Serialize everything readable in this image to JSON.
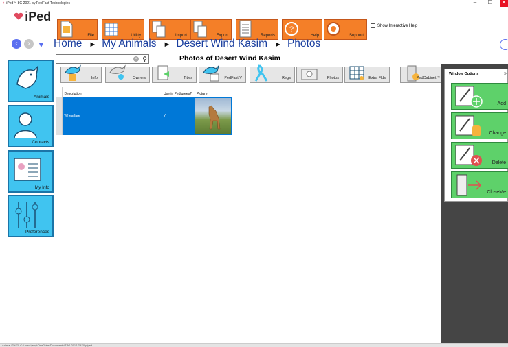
{
  "window": {
    "title": "iPed™ 8G 2021 by PedFast Technologies",
    "min_glyph": "–",
    "max_glyph": "☐",
    "close_glyph": "✕"
  },
  "logo": {
    "text": "iPed"
  },
  "toolbar": {
    "buttons": [
      {
        "label": "File",
        "icon": "file-icon"
      },
      {
        "label": "Utility",
        "icon": "utility-icon"
      },
      {
        "label": "Import",
        "icon": "import-icon"
      },
      {
        "label": "Export",
        "icon": "export-icon"
      },
      {
        "label": "Reports",
        "icon": "reports-icon"
      },
      {
        "label": "Help",
        "icon": "help-icon"
      },
      {
        "label": "Support",
        "icon": "support-icon"
      }
    ],
    "show_help_label": "Show Interactive Help",
    "show_help_checked": false
  },
  "breadcrumb": [
    "Home",
    "My Animals",
    "Desert Wind Kasim",
    "Photos"
  ],
  "breadcrumb_separator": "►",
  "nav": {
    "back_glyph": "‹",
    "fwd_glyph": "›",
    "menu_glyph": "▼"
  },
  "left_nav": [
    {
      "label": "Animals",
      "icon": "dog-head-icon"
    },
    {
      "label": "Contacts",
      "icon": "person-icon"
    },
    {
      "label": "My Info",
      "icon": "id-card-icon"
    },
    {
      "label": "Preferences",
      "icon": "sliders-icon"
    }
  ],
  "search": {
    "value": "",
    "placeholder": "",
    "clear_glyph": "×",
    "find_glyph": "⚲"
  },
  "page_title": "Photos of Desert Wind Kasim",
  "tabs": [
    {
      "label": "Info"
    },
    {
      "label": "Owners"
    },
    {
      "label": "Titles"
    },
    {
      "label": "PedFast V"
    },
    {
      "label": "Regs"
    },
    {
      "label": "Photos"
    },
    {
      "label": "Extra Flds"
    },
    {
      "label": "PedCabinet™"
    }
  ],
  "grid": {
    "columns": [
      "Description",
      "Use in Pedigrees?",
      "Picture"
    ],
    "rows": [
      {
        "description": "Wheatfare",
        "use_in_pedigrees": "Y",
        "picture": "dog-photo"
      }
    ]
  },
  "window_options": {
    "title": "Window Options",
    "pin_glyph": "»",
    "buttons": [
      {
        "label": "Add",
        "icon": "add-icon"
      },
      {
        "label": "Change",
        "icon": "change-icon"
      },
      {
        "label": "Delete",
        "icon": "delete-icon"
      },
      {
        "label": "CloseMe",
        "icon": "close-me-icon"
      }
    ]
  },
  "status_bar": "Animal ID# 70   C:\\Users\\jerry\\OneDrive\\Documents\\TPG 2012 D470.pfped",
  "colors": {
    "toolbar_orange": "#f47f28",
    "nav_blue": "#40c4f0",
    "breadcrumb_blue": "#1b3f9f",
    "option_green": "#5ed16a",
    "selection_blue": "#0078d7",
    "panel_dark": "#454545"
  }
}
